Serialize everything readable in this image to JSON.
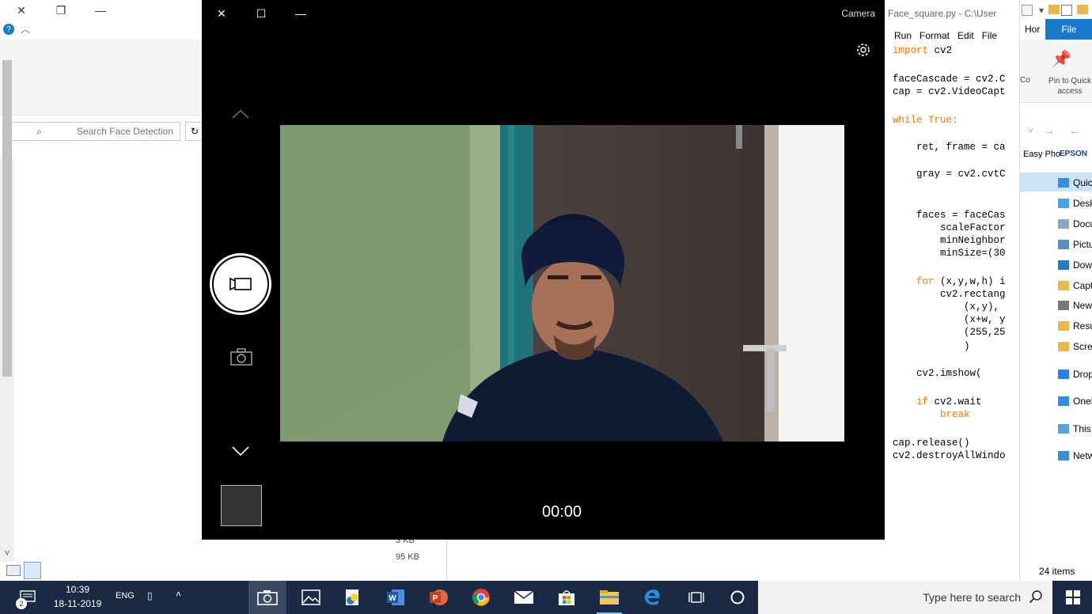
{
  "left_explorer": {
    "search_placeholder": "Search Face Detection",
    "help_badge": "?",
    "size_1": "3 KB",
    "size_2": "95 KB"
  },
  "camera": {
    "title": "Camera",
    "timer": "00:00"
  },
  "idle": {
    "title": "Face_square.py - C:\\User",
    "menu": [
      "File",
      "Edit",
      "Format",
      "Run"
    ],
    "code": [
      {
        "text": "import cv2",
        "kw": "import"
      },
      {
        "text": "faceCascade = cv2.C",
        "kw": ""
      },
      {
        "text": "cap = cv2.VideoCapt",
        "kw": ""
      },
      {
        "text": "while True:",
        "kw": "while True:"
      },
      {
        "text": "    ret, frame = ca",
        "kw": ""
      },
      {
        "text": "    gray = cv2.cvtC",
        "kw": ""
      },
      {
        "text": "    faces = faceCas",
        "kw": ""
      },
      {
        "text": "        scaleFactor",
        "kw": ""
      },
      {
        "text": "        minNeighbor",
        "kw": ""
      },
      {
        "text": "        minSize=(30",
        "kw": ""
      },
      {
        "text": "    for (x,y,w,h) i",
        "kw": "for"
      },
      {
        "text": "        cv2.rectang",
        "kw": ""
      },
      {
        "text": "            (x,y),",
        "kw": ""
      },
      {
        "text": "            (x+w, y",
        "kw": ""
      },
      {
        "text": "            (255,25",
        "kw": ""
      },
      {
        "text": "            )",
        "kw": ""
      },
      {
        "text": "    cv2.imshow(",
        "kw": ""
      },
      {
        "text": "    if cv2.wait",
        "kw": "if"
      },
      {
        "text": "        break",
        "kw": "break"
      },
      {
        "text": "cap.release()",
        "kw": ""
      },
      {
        "text": "cv2.destroyAllWindo",
        "kw": ""
      }
    ]
  },
  "right_explorer": {
    "file_tab": "File",
    "home_tab": "Hor",
    "pin_label": "Pin to Quick access",
    "copy_label": "Co",
    "epson": "EPSON",
    "easy_photo": "Easy Pho",
    "nav": [
      "Quick ac",
      "Deskto",
      "Docum",
      "Picture",
      "Downl",
      "Captur",
      "New V",
      "Resum",
      "Screen",
      "Dropbo",
      "OneDriv",
      "This PC",
      "Network"
    ],
    "items_count": "24 items"
  },
  "taskbar": {
    "search_placeholder": "Type here to search",
    "time": "10:39",
    "date": "18-11-2019",
    "lang": "ENG",
    "notif_count": "2"
  },
  "colors": {
    "file_tab": "#1979ca",
    "taskbar": "#1b2a44",
    "code_keyword": "#ff7700"
  }
}
